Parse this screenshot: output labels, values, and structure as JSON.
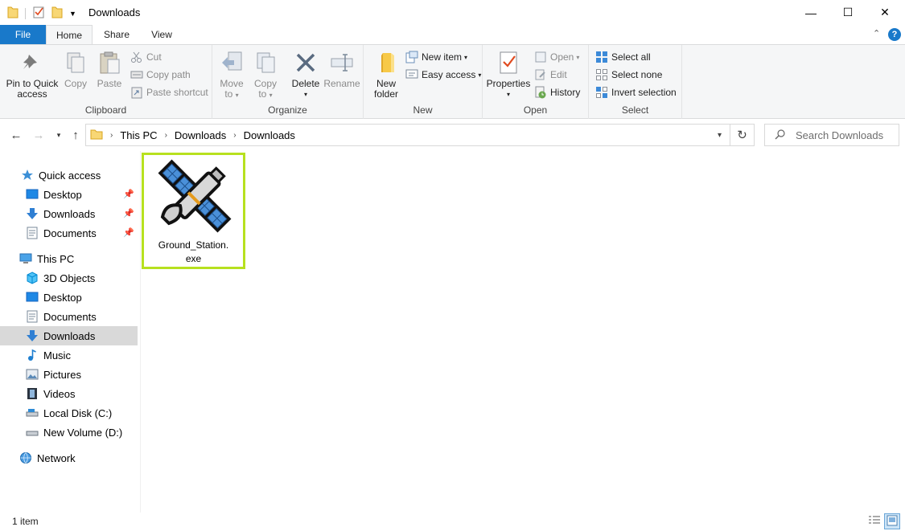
{
  "window": {
    "title": "Downloads",
    "minimize_glyph": "—",
    "maximize_glyph": "☐",
    "close_glyph": "✕"
  },
  "ribbon_tabs": {
    "file": "File",
    "home": "Home",
    "share": "Share",
    "view": "View"
  },
  "ribbon": {
    "clipboard": {
      "label": "Clipboard",
      "pin_line1": "Pin to Quick",
      "pin_line2": "access",
      "copy": "Copy",
      "paste": "Paste",
      "cut": "Cut",
      "copy_path": "Copy path",
      "paste_shortcut": "Paste shortcut"
    },
    "organize": {
      "label": "Organize",
      "move_line1": "Move",
      "move_line2": "to",
      "copy_line1": "Copy",
      "copy_line2": "to",
      "delete": "Delete",
      "rename": "Rename"
    },
    "new": {
      "label": "New",
      "new_folder_line1": "New",
      "new_folder_line2": "folder",
      "new_item": "New item",
      "easy_access": "Easy access"
    },
    "open": {
      "label": "Open",
      "properties": "Properties",
      "open": "Open",
      "edit": "Edit",
      "history": "History"
    },
    "select": {
      "label": "Select",
      "select_all": "Select all",
      "select_none": "Select none",
      "invert_selection": "Invert selection"
    }
  },
  "address": {
    "crumbs": [
      "This PC",
      "Downloads",
      "Downloads"
    ],
    "search_placeholder": "Search Downloads"
  },
  "nav": {
    "quick_access": "Quick access",
    "qa_desktop": "Desktop",
    "qa_downloads": "Downloads",
    "qa_documents": "Documents",
    "this_pc": "This PC",
    "objects3d": "3D Objects",
    "desktop": "Desktop",
    "documents": "Documents",
    "downloads": "Downloads",
    "music": "Music",
    "pictures": "Pictures",
    "videos": "Videos",
    "local_disk": "Local Disk (C:)",
    "new_volume": "New Volume (D:)",
    "network": "Network"
  },
  "files": [
    {
      "name_line1": "Ground_Station.",
      "name_line2": "exe",
      "icon": "satellite-icon"
    }
  ],
  "status": {
    "item_count": "1 item"
  },
  "colors": {
    "file_tab": "#1979ca",
    "selection_highlight": "#b7e11f",
    "nav_selected": "#d9d9d9"
  }
}
